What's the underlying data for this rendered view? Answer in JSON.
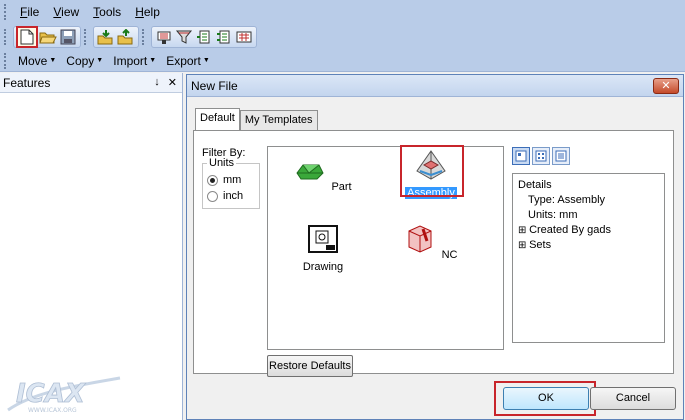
{
  "menubar": {
    "items": [
      {
        "prefix": "",
        "u": "F",
        "rest": "ile"
      },
      {
        "prefix": "",
        "u": "V",
        "rest": "iew"
      },
      {
        "prefix": "",
        "u": "T",
        "rest": "ools"
      },
      {
        "prefix": "",
        "u": "H",
        "rest": "elp"
      }
    ]
  },
  "toolbar2": {
    "move": "Move",
    "copy": "Copy",
    "import": "Import",
    "export": "Export"
  },
  "features": {
    "title": "Features",
    "pin": "↓",
    "close": "✕"
  },
  "dialog": {
    "title": "New File",
    "close_glyph": "✕",
    "tabs": {
      "default": "Default",
      "my_templates": "My Templates"
    },
    "filter": {
      "label": "Filter By:",
      "units_label": "Units",
      "mm": "mm",
      "inch": "inch",
      "selected": "mm"
    },
    "files": {
      "part": "Part",
      "assembly": "Assembly",
      "drawing": "Drawing",
      "nc": "NC"
    },
    "details": {
      "label": "Details",
      "type": "Type: Assembly",
      "units": "Units: mm",
      "created_by": "Created By gads",
      "sets": "Sets",
      "expand": "⊞"
    },
    "restore": "Restore Defaults",
    "ok": "OK",
    "cancel": "Cancel"
  },
  "colors": {
    "accent": "#3399ff",
    "highlight": "#c8252b",
    "toolbar": "#b9cce8"
  },
  "watermark": {
    "brand": "ICAX",
    "url": "WWW.ICAX.ORG"
  }
}
